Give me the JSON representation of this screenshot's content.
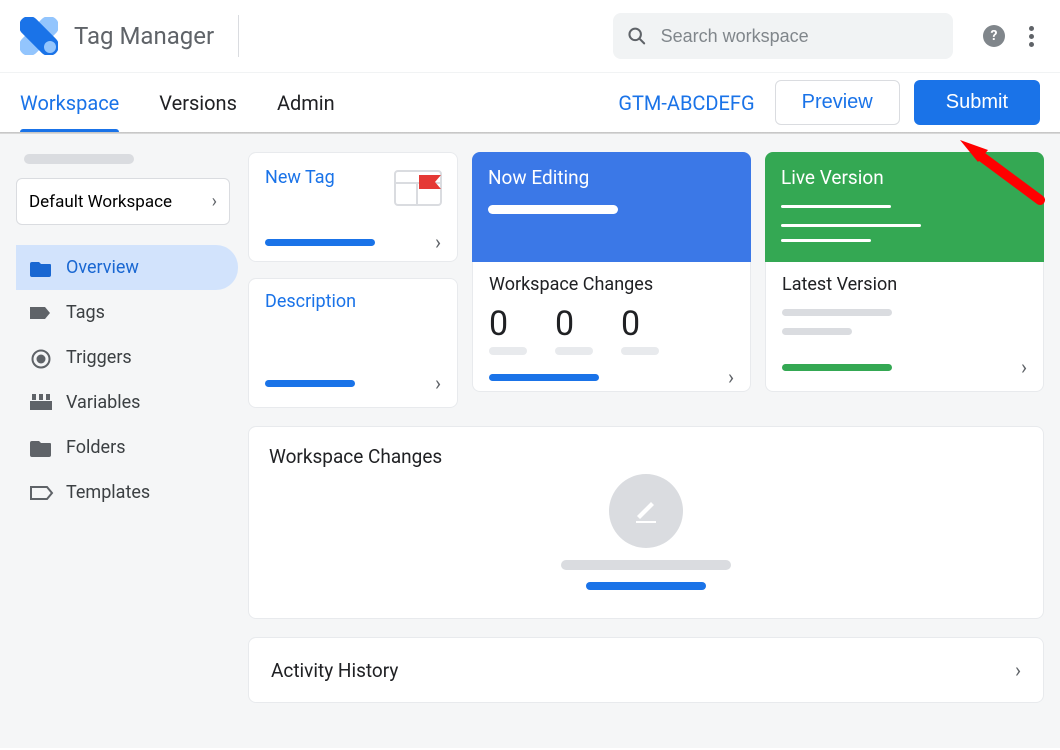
{
  "app": {
    "title": "Tag Manager"
  },
  "search": {
    "placeholder": "Search workspace"
  },
  "tabs": {
    "workspace": "Workspace",
    "versions": "Versions",
    "admin": "Admin"
  },
  "containerId": "GTM-ABCDEFG",
  "buttons": {
    "preview": "Preview",
    "submit": "Submit"
  },
  "sidebar": {
    "workspaceSelectorLabel": "Default Workspace",
    "items": [
      {
        "label": "Overview"
      },
      {
        "label": "Tags"
      },
      {
        "label": "Triggers"
      },
      {
        "label": "Variables"
      },
      {
        "label": "Folders"
      },
      {
        "label": "Templates"
      }
    ]
  },
  "cards": {
    "newTag": "New Tag",
    "nowEditing": "Now Editing",
    "liveVersion": "Live Version",
    "description": "Description",
    "workspaceChanges": "Workspace Changes",
    "latestVersion": "Latest Version"
  },
  "workspaceChangesCounts": [
    "0",
    "0",
    "0"
  ],
  "panels": {
    "workspaceChanges": "Workspace Changes",
    "activityHistory": "Activity History"
  }
}
